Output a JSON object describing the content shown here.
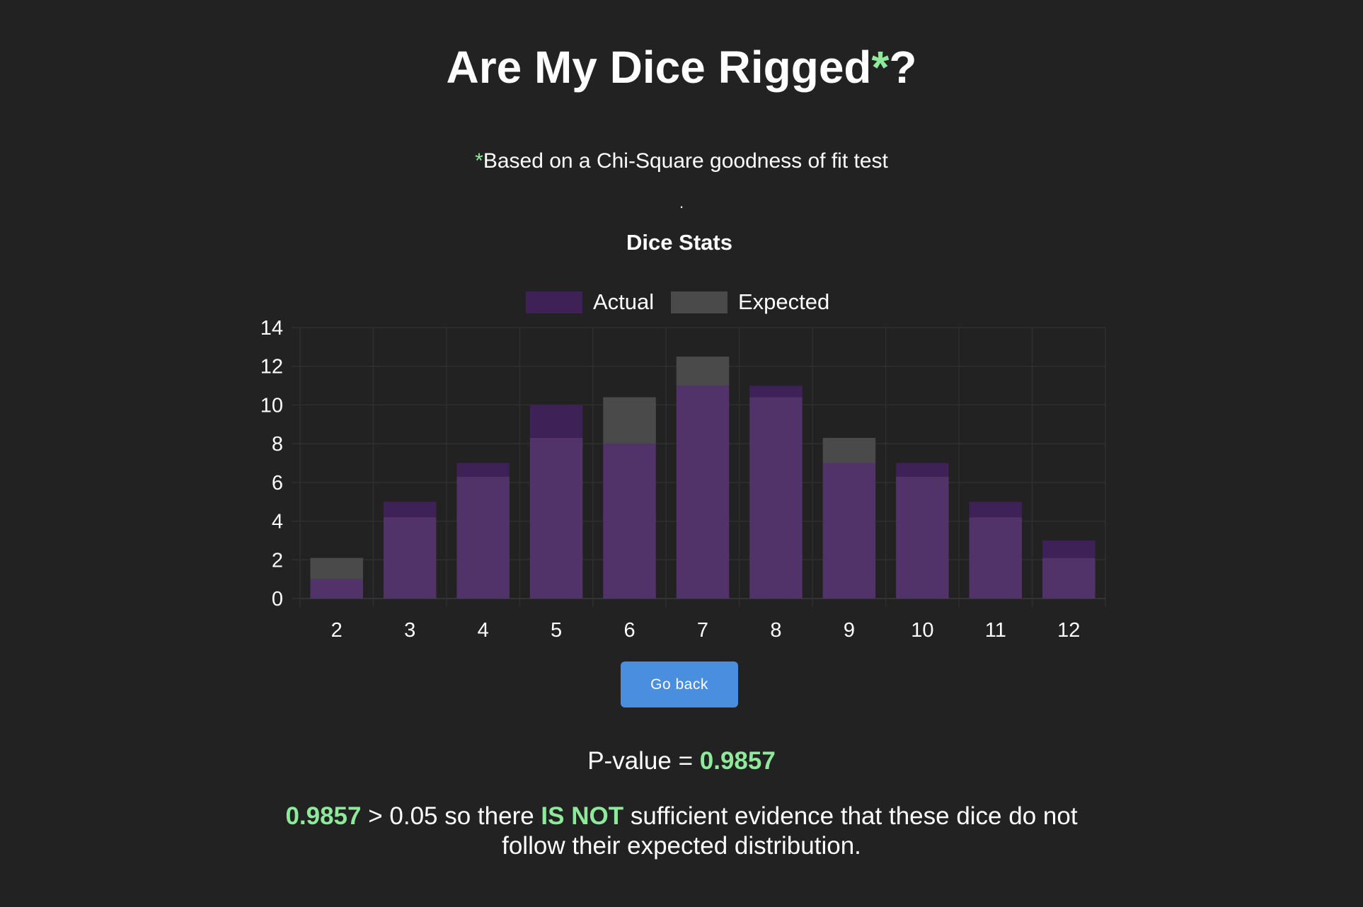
{
  "header": {
    "title_main": "Are My Dice Rigged",
    "title_asterisk": "*",
    "title_end": "?",
    "subtitle_asterisk": "*",
    "subtitle_text": "Based on a Chi-Square goodness of fit test",
    "dot": "."
  },
  "colors": {
    "accent": "#8ee99a",
    "actual": "#3d2157",
    "actual_overlap": "#523369",
    "expected": "#4a4a4a",
    "button": "#4a8ee0",
    "background": "#222222"
  },
  "chart_data": {
    "type": "bar",
    "title": "Dice Stats",
    "categories": [
      "2",
      "3",
      "4",
      "5",
      "6",
      "7",
      "8",
      "9",
      "10",
      "11",
      "12"
    ],
    "series": [
      {
        "name": "Actual",
        "values": [
          1,
          5,
          7,
          10,
          8,
          11,
          11,
          7,
          7,
          5,
          3
        ]
      },
      {
        "name": "Expected",
        "values": [
          2.1,
          4.2,
          6.3,
          8.3,
          10.4,
          12.5,
          10.4,
          8.3,
          6.3,
          4.2,
          2.1
        ]
      }
    ],
    "ylim": [
      0,
      14
    ],
    "yticks": [
      "0",
      "2",
      "4",
      "6",
      "8",
      "10",
      "12",
      "14"
    ],
    "grid": true,
    "legend": "top-center",
    "overlapping_bars": true
  },
  "actions": {
    "go_back_label": "Go back"
  },
  "result": {
    "pvalue_label": "P-value = ",
    "pvalue": "0.9857",
    "conclusion_value": "0.9857",
    "conclusion_part1": " > 0.05 so there ",
    "conclusion_emphasis": "IS NOT",
    "conclusion_part2": " sufficient evidence that these dice do not follow their expected distribution."
  }
}
